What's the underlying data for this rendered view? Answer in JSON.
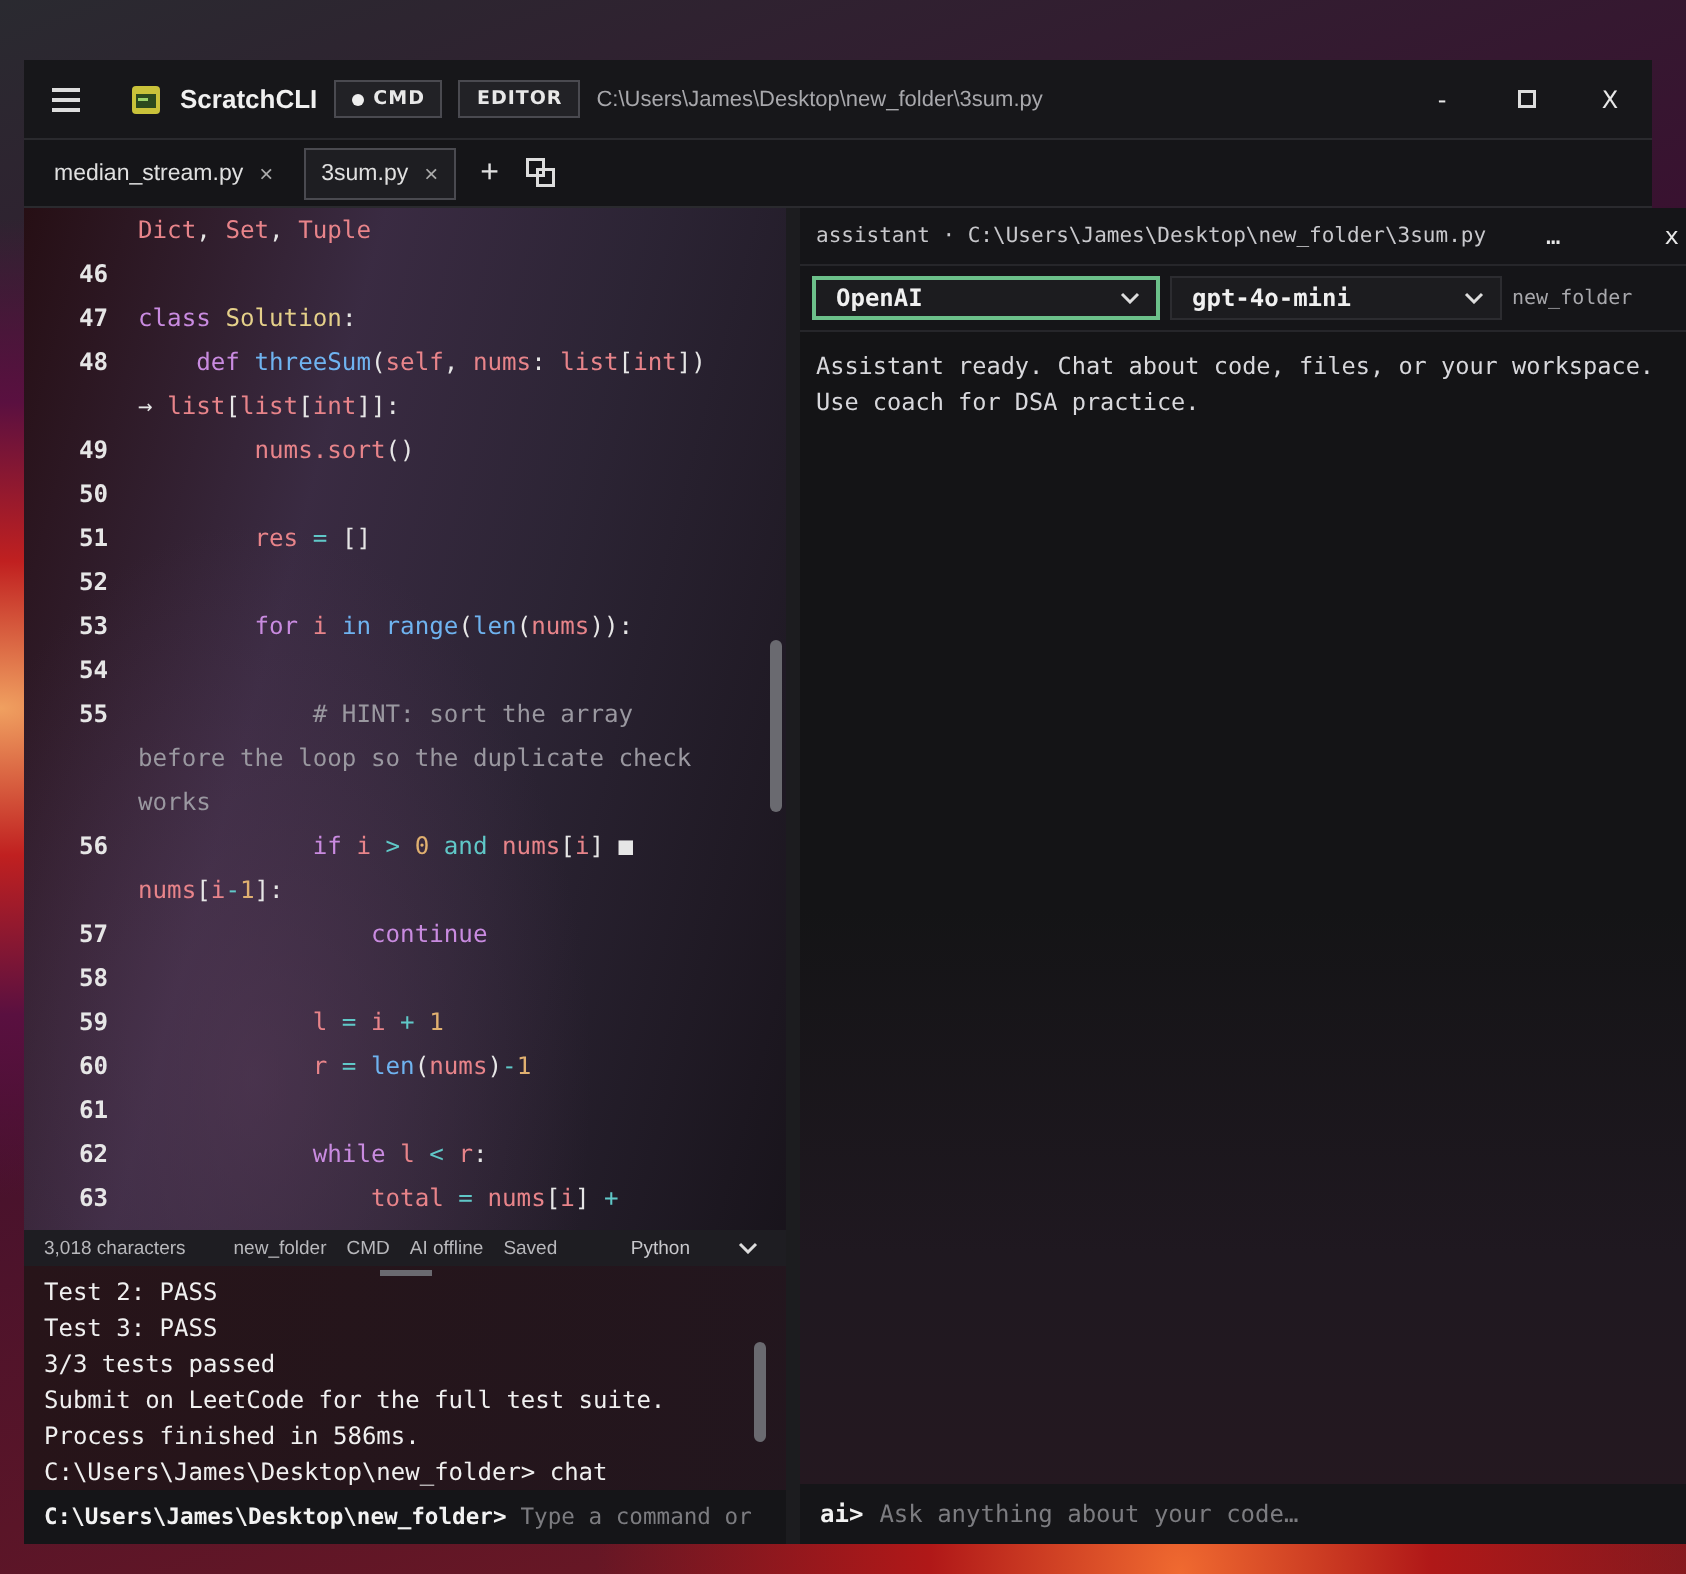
{
  "window": {
    "app_name": "ScratchCLI",
    "modes": [
      {
        "label": "CMD",
        "selected": true
      },
      {
        "label": "EDITOR",
        "selected": false
      }
    ],
    "path": "C:\\Users\\James\\Desktop\\new_folder\\3sum.py",
    "minimize": "-",
    "close": "X"
  },
  "tabs": [
    {
      "label": "median_stream.py",
      "close": "×",
      "selected": false
    },
    {
      "label": "3sum.py",
      "close": "×",
      "selected": true
    }
  ],
  "new_tab": "+",
  "editor": {
    "lines": [
      {
        "tokens": [
          {
            "kind": "variable",
            "text": "Dict"
          },
          {
            "kind": "text",
            "text": ", "
          },
          {
            "kind": "variable",
            "text": "Set"
          },
          {
            "kind": "text",
            "text": ", "
          },
          {
            "kind": "variable",
            "text": "Tuple"
          }
        ]
      },
      {
        "number": "46"
      },
      {
        "number": "47",
        "tokens": [
          {
            "kind": "keyword",
            "text": "class "
          },
          {
            "kind": "class",
            "text": "Solution"
          },
          {
            "kind": "text",
            "text": ":"
          }
        ]
      },
      {
        "number": "48",
        "tokens": [
          {
            "kind": "keyword",
            "text": "    def "
          },
          {
            "kind": "function",
            "text": "threeSum"
          },
          {
            "kind": "text",
            "text": "("
          },
          {
            "kind": "variable",
            "text": "self"
          },
          {
            "kind": "text",
            "text": ", "
          },
          {
            "kind": "variable",
            "text": "nums"
          },
          {
            "kind": "text",
            "text": ": "
          },
          {
            "kind": "variable",
            "text": "list"
          },
          {
            "kind": "text",
            "text": "["
          },
          {
            "kind": "variable",
            "text": "int"
          },
          {
            "kind": "text",
            "text": "])"
          }
        ]
      },
      {
        "tokens": [
          {
            "kind": "text",
            "text": "→ "
          },
          {
            "kind": "variable",
            "text": "list"
          },
          {
            "kind": "text",
            "text": "["
          },
          {
            "kind": "variable",
            "text": "list"
          },
          {
            "kind": "text",
            "text": "["
          },
          {
            "kind": "variable",
            "text": "int"
          },
          {
            "kind": "text",
            "text": "]]:"
          }
        ]
      },
      {
        "number": "49",
        "tokens": [
          {
            "kind": "variable",
            "text": "        nums.sort"
          },
          {
            "kind": "text",
            "text": "()"
          }
        ]
      },
      {
        "number": "50"
      },
      {
        "number": "51",
        "tokens": [
          {
            "kind": "variable",
            "text": "        res"
          },
          {
            "kind": "operator",
            "text": " = "
          },
          {
            "kind": "text",
            "text": "[]"
          }
        ]
      },
      {
        "number": "52"
      },
      {
        "number": "53",
        "tokens": [
          {
            "kind": "keyword",
            "text": "        for "
          },
          {
            "kind": "variable",
            "text": "i "
          },
          {
            "kind": "function",
            "text": "in range"
          },
          {
            "kind": "text",
            "text": "("
          },
          {
            "kind": "function",
            "text": "len"
          },
          {
            "kind": "text",
            "text": "("
          },
          {
            "kind": "variable",
            "text": "nums"
          },
          {
            "kind": "text",
            "text": ")):"
          }
        ]
      },
      {
        "number": "54"
      },
      {
        "number": "55",
        "tokens": [
          {
            "kind": "comment",
            "text": "            # HINT: sort the array"
          }
        ]
      },
      {
        "tokens": [
          {
            "kind": "comment",
            "text": "before the loop so the duplicate check"
          }
        ]
      },
      {
        "tokens": [
          {
            "kind": "comment",
            "text": "works"
          }
        ]
      },
      {
        "number": "56",
        "tokens": [
          {
            "kind": "keyword",
            "text": "            if "
          },
          {
            "kind": "variable",
            "text": "i"
          },
          {
            "kind": "operator",
            "text": " > "
          },
          {
            "kind": "number",
            "text": "0"
          },
          {
            "kind": "operator",
            "text": " and "
          },
          {
            "kind": "variable",
            "text": "nums"
          },
          {
            "kind": "text",
            "text": "["
          },
          {
            "kind": "variable",
            "text": "i"
          },
          {
            "kind": "text",
            "text": "] ■"
          }
        ]
      },
      {
        "tokens": [
          {
            "kind": "variable",
            "text": "nums"
          },
          {
            "kind": "text",
            "text": "["
          },
          {
            "kind": "variable",
            "text": "i"
          },
          {
            "kind": "operator",
            "text": "-"
          },
          {
            "kind": "number",
            "text": "1"
          },
          {
            "kind": "text",
            "text": "]:"
          }
        ]
      },
      {
        "number": "57",
        "tokens": [
          {
            "kind": "keyword",
            "text": "                continue"
          }
        ]
      },
      {
        "number": "58"
      },
      {
        "number": "59",
        "tokens": [
          {
            "kind": "variable",
            "text": "            l"
          },
          {
            "kind": "operator",
            "text": " = "
          },
          {
            "kind": "variable",
            "text": "i"
          },
          {
            "kind": "operator",
            "text": " + "
          },
          {
            "kind": "number",
            "text": "1"
          }
        ]
      },
      {
        "number": "60",
        "tokens": [
          {
            "kind": "variable",
            "text": "            r"
          },
          {
            "kind": "operator",
            "text": " = "
          },
          {
            "kind": "function",
            "text": "len"
          },
          {
            "kind": "text",
            "text": "("
          },
          {
            "kind": "variable",
            "text": "nums"
          },
          {
            "kind": "text",
            "text": ")"
          },
          {
            "kind": "operator",
            "text": "-"
          },
          {
            "kind": "number",
            "text": "1"
          }
        ]
      },
      {
        "number": "61"
      },
      {
        "number": "62",
        "tokens": [
          {
            "kind": "keyword",
            "text": "            while "
          },
          {
            "kind": "variable",
            "text": "l"
          },
          {
            "kind": "operator",
            "text": " < "
          },
          {
            "kind": "variable",
            "text": "r"
          },
          {
            "kind": "text",
            "text": ":"
          }
        ]
      },
      {
        "number": "63",
        "tokens": [
          {
            "kind": "variable",
            "text": "                total"
          },
          {
            "kind": "operator",
            "text": " = "
          },
          {
            "kind": "variable",
            "text": "nums"
          },
          {
            "kind": "text",
            "text": "["
          },
          {
            "kind": "variable",
            "text": "i"
          },
          {
            "kind": "text",
            "text": "]"
          },
          {
            "kind": "operator",
            "text": " +"
          }
        ]
      }
    ]
  },
  "status_bar": {
    "items": [
      "3,018 characters",
      "new_folder",
      "CMD",
      "AI offline",
      "Saved"
    ],
    "language": "Python"
  },
  "terminal": {
    "lines": [
      "Test 2: PASS",
      "Test 3: PASS",
      "3/3 tests passed",
      "Submit on LeetCode for the full test suite.",
      "Process finished in 586ms.",
      "C:\\Users\\James\\Desktop\\new_folder> chat"
    ],
    "prompt": "C:\\Users\\James\\Desktop\\new_folder>",
    "placeholder": "Type a command or"
  },
  "assistant": {
    "title": "assistant · C:\\Users\\James\\Desktop\\new_folder\\3sum.py",
    "minimize": "…",
    "close": "x",
    "selects": [
      {
        "value": "OpenAI",
        "focused": true
      },
      {
        "value": "gpt-4o-mini",
        "focused": false
      }
    ],
    "folder": "new_folder",
    "messages": [
      "Assistant ready. Chat about code, files, or your workspace.",
      "Use coach for DSA practice."
    ],
    "prompt": "ai>",
    "placeholder": "Ask anything about your code…"
  }
}
